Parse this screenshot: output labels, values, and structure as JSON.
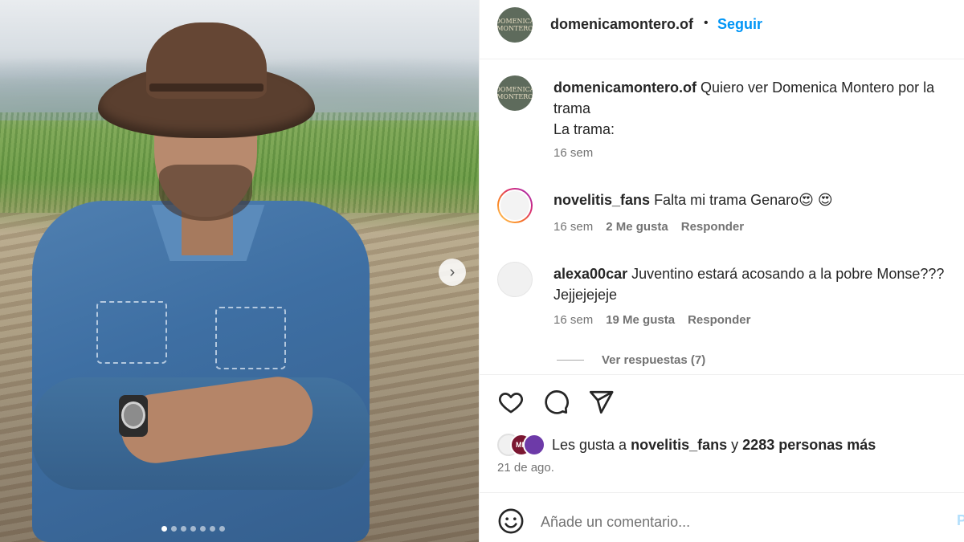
{
  "photo": {
    "alt_subject": "",
    "carousel_dots": 7,
    "active_dot": 0
  },
  "post_header": {
    "avatar_text": "DOMENICA MONTERO",
    "username": "domenicamontero.of",
    "separator": "•",
    "follow_label": "Seguir"
  },
  "comments": [
    {
      "username": "domenicamontero.of",
      "text_line1": "Quiero ver Domenica Montero por la",
      "text_line2": "trama",
      "text_line3": "La trama:",
      "time": "16 sem"
    },
    {
      "username": "novelitis_fans",
      "text": "Falta mi trama Genaro😍 😍",
      "time": "16 sem",
      "likes": "2 Me gusta",
      "reply": "Responder"
    },
    {
      "username": "alexa00car",
      "text_line1": "Juventino estará acosando a la pobre Monse???",
      "text_line2": "Jejjejejeje",
      "time": "16 sem",
      "likes": "19 Me gusta",
      "reply": "Responder"
    }
  ],
  "view_replies": "Ver respuestas (7)",
  "likes_summary": {
    "prefix": "Les gusta a",
    "user": "novelitis_fans",
    "middle": "y",
    "count": "2283 personas más",
    "avatar_badge": "MN"
  },
  "post_date": "21 de ago.",
  "add_comment": {
    "placeholder": "Añade un comentario...",
    "post_label": "P"
  },
  "colors": {
    "accent": "#0095f6",
    "text": "#262626",
    "muted": "#737373"
  }
}
